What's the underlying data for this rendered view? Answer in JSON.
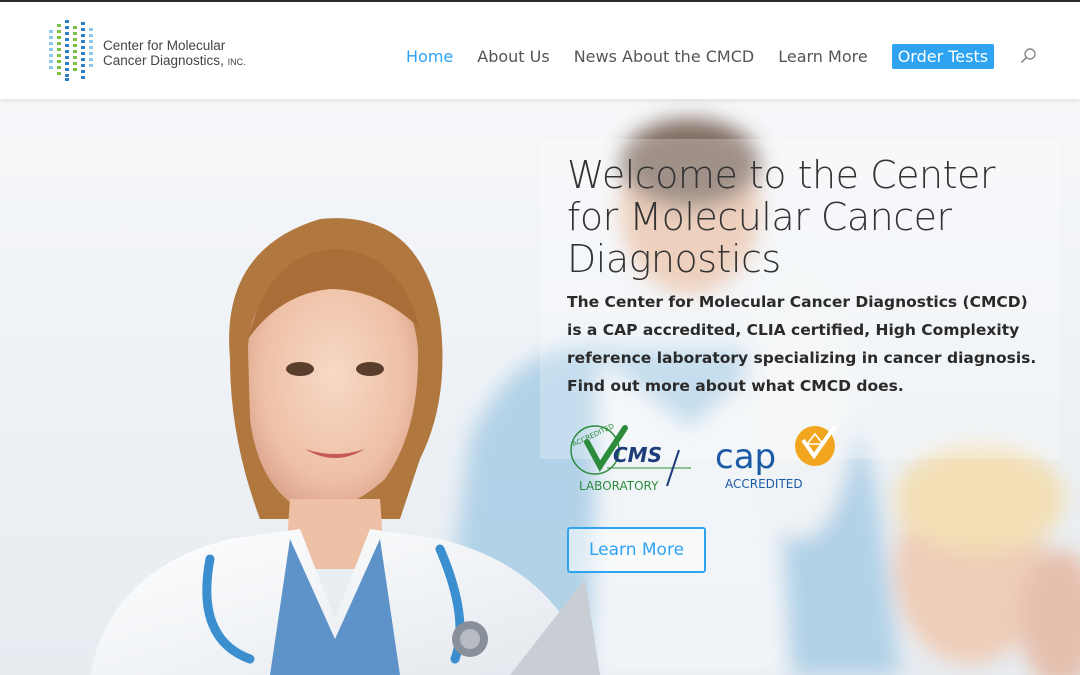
{
  "brand": {
    "line1": "Center for Molecular",
    "line2": "Cancer Diagnostics",
    "suffix": "INC.",
    "colors": {
      "blue": "#2e7fc4",
      "green": "#7cc242",
      "lightblue": "#8cc8ee"
    }
  },
  "nav": {
    "items": [
      {
        "label": "Home",
        "active": true
      },
      {
        "label": "About Us"
      },
      {
        "label": "News About the CMCD"
      },
      {
        "label": "Learn More"
      }
    ],
    "cta_label": "Order Tests",
    "search_icon": "search-icon",
    "accent": "#2ea3f2"
  },
  "hero": {
    "title": "Welcome to the Center for Molecular Cancer Diagnostics",
    "description": "The Center for Molecular Cancer Diagnostics (CMCD) is a CAP accredited, CLIA certified, High Complexity reference laboratory specializing in cancer diagnosis. Find out more about what CMCD does.",
    "button_label": "Learn More",
    "badges": {
      "cms_accredited": "ACCREDITED",
      "cms_mark": "CMS",
      "cms_lab": "LABORATORY",
      "cap_mark": "cap",
      "cap_accredited": "ACCREDITED"
    }
  }
}
